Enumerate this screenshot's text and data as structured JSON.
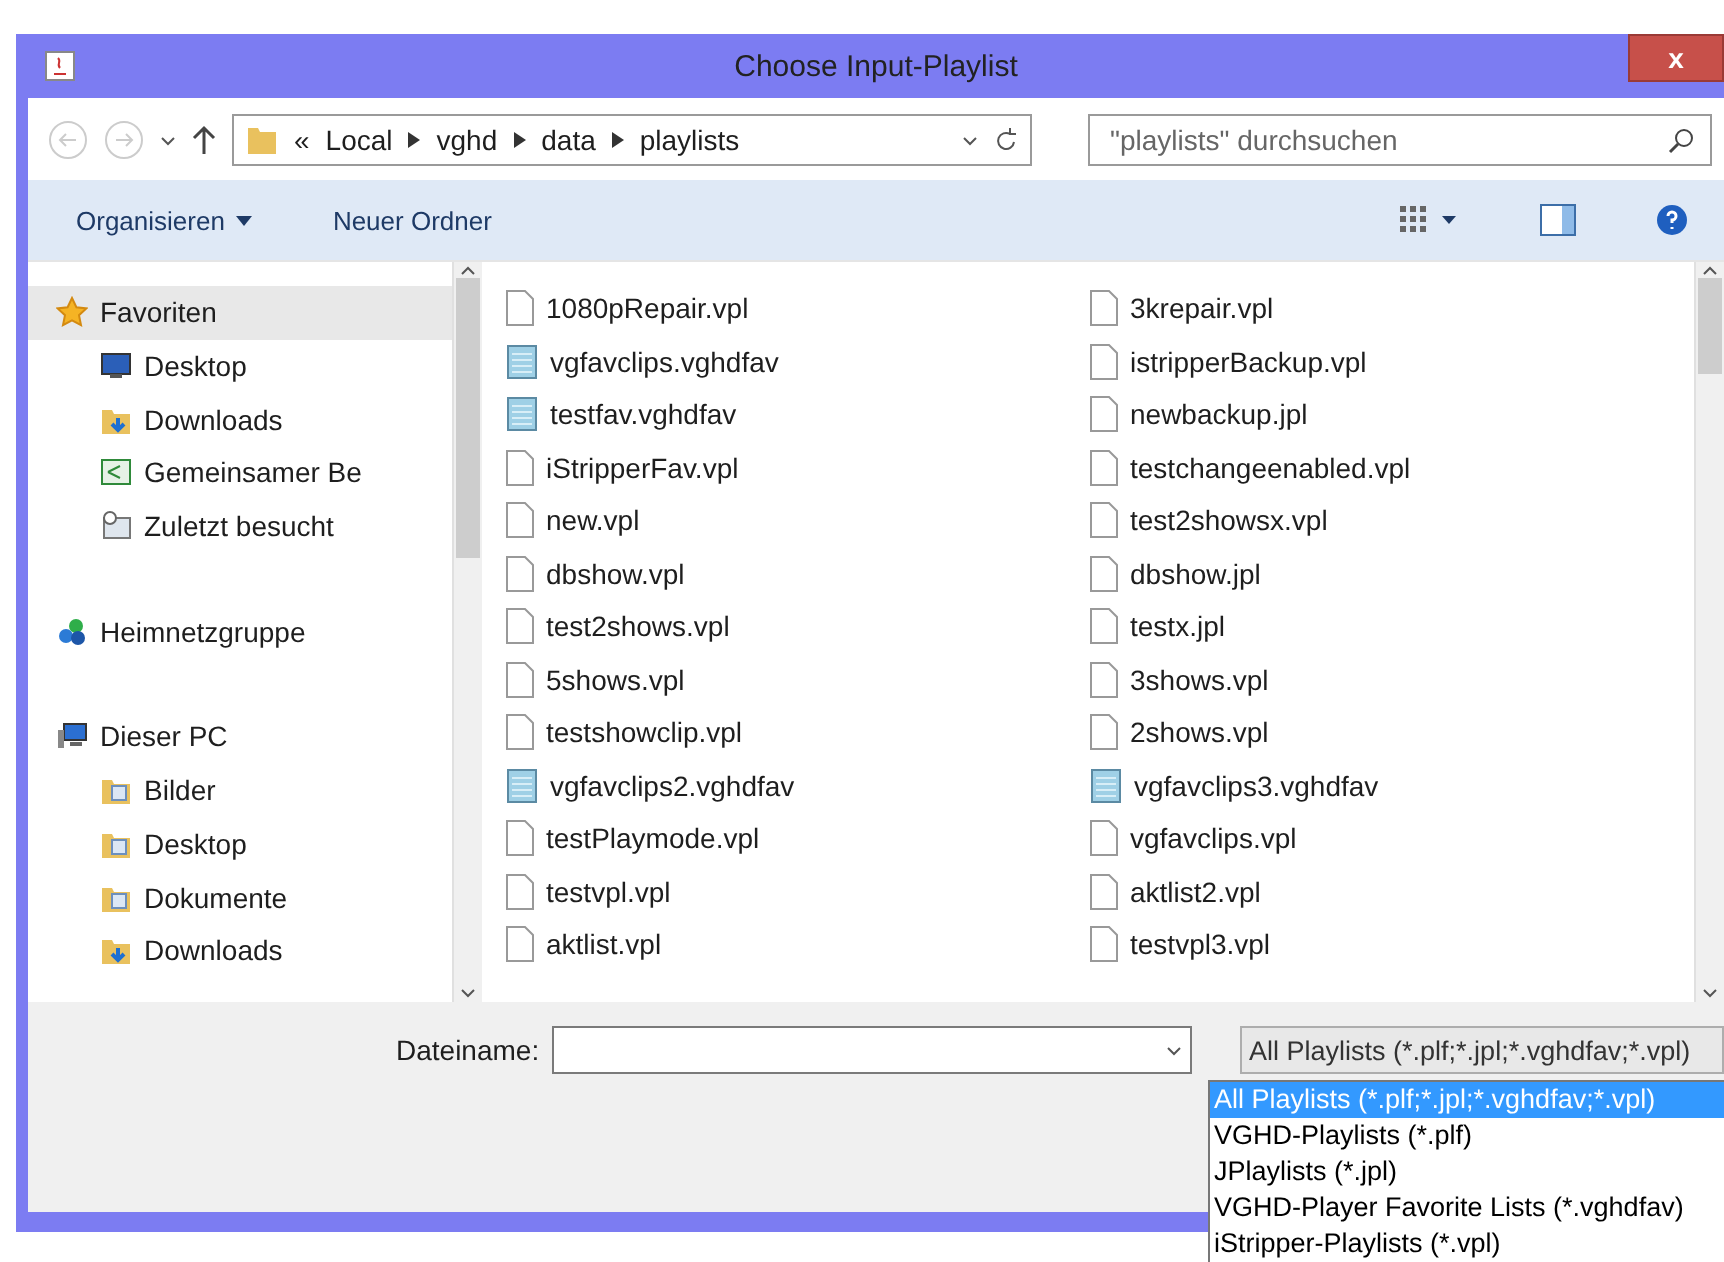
{
  "window": {
    "title": "Choose Input-Playlist",
    "close": "x"
  },
  "address": {
    "overflow": "«",
    "crumbs": [
      "Local",
      "vghd",
      "data",
      "playlists"
    ]
  },
  "search": {
    "placeholder": "\"playlists\" durchsuchen"
  },
  "toolbar": {
    "organize": "Organisieren",
    "new_folder": "Neuer Ordner"
  },
  "nav": [
    {
      "label": "Favoriten",
      "kind": "star",
      "selected": true,
      "children": [
        {
          "label": "Desktop",
          "kind": "monitor",
          "selected": false
        },
        {
          "label": "Downloads",
          "kind": "download",
          "selected": false
        },
        {
          "label": "Gemeinsamer Be",
          "kind": "share",
          "selected": false
        },
        {
          "label": "Zuletzt besucht",
          "kind": "recent",
          "selected": false
        }
      ]
    },
    {
      "label": "Heimnetzgruppe",
      "kind": "network",
      "selected": false
    },
    {
      "label": "Dieser PC",
      "kind": "computer",
      "selected": false,
      "children": [
        {
          "label": "Bilder",
          "kind": "folder",
          "selected": false
        },
        {
          "label": "Desktop",
          "kind": "folder",
          "selected": false
        },
        {
          "label": "Dokumente",
          "kind": "folder",
          "selected": false
        },
        {
          "label": "Downloads",
          "kind": "download",
          "selected": false
        }
      ]
    }
  ],
  "files": [
    {
      "name": "1080pRepair.vpl",
      "kind": "doc"
    },
    {
      "name": "vgfavclips.vghdfav",
      "kind": "note"
    },
    {
      "name": "testfav.vghdfav",
      "kind": "note"
    },
    {
      "name": "iStripperFav.vpl",
      "kind": "doc"
    },
    {
      "name": "new.vpl",
      "kind": "doc"
    },
    {
      "name": "dbshow.vpl",
      "kind": "doc"
    },
    {
      "name": "test2shows.vpl",
      "kind": "doc"
    },
    {
      "name": "5shows.vpl",
      "kind": "doc"
    },
    {
      "name": "testshowclip.vpl",
      "kind": "doc"
    },
    {
      "name": "vgfavclips2.vghdfav",
      "kind": "note"
    },
    {
      "name": "testPlaymode.vpl",
      "kind": "doc"
    },
    {
      "name": "testvpl.vpl",
      "kind": "doc"
    },
    {
      "name": "aktlist.vpl",
      "kind": "doc"
    },
    {
      "name": "3krepair.vpl",
      "kind": "doc"
    },
    {
      "name": "istripperBackup.vpl",
      "kind": "doc"
    },
    {
      "name": "newbackup.jpl",
      "kind": "doc"
    },
    {
      "name": "testchangeenabled.vpl",
      "kind": "doc"
    },
    {
      "name": "test2showsx.vpl",
      "kind": "doc"
    },
    {
      "name": "dbshow.jpl",
      "kind": "doc"
    },
    {
      "name": "testx.jpl",
      "kind": "doc"
    },
    {
      "name": "3shows.vpl",
      "kind": "doc"
    },
    {
      "name": "2shows.vpl",
      "kind": "doc"
    },
    {
      "name": "vgfavclips3.vghdfav",
      "kind": "note"
    },
    {
      "name": "vgfavclips.vpl",
      "kind": "doc"
    },
    {
      "name": "aktlist2.vpl",
      "kind": "doc"
    },
    {
      "name": "testvpl3.vpl",
      "kind": "doc"
    }
  ],
  "filename": {
    "label": "Dateiname:"
  },
  "filter": {
    "value": "All Playlists (*.plf;*.jpl;*.vghdfav;*.vpl)",
    "options": [
      {
        "label": "All Playlists (*.plf;*.jpl;*.vghdfav;*.vpl)",
        "selected": true
      },
      {
        "label": "VGHD-Playlists (*.plf)",
        "selected": false
      },
      {
        "label": "JPlaylists (*.jpl)",
        "selected": false
      },
      {
        "label": "VGHD-Player Favorite Lists (*.vghdfav)",
        "selected": false
      },
      {
        "label": "iStripper-Playlists (*.vpl)",
        "selected": false
      }
    ]
  }
}
